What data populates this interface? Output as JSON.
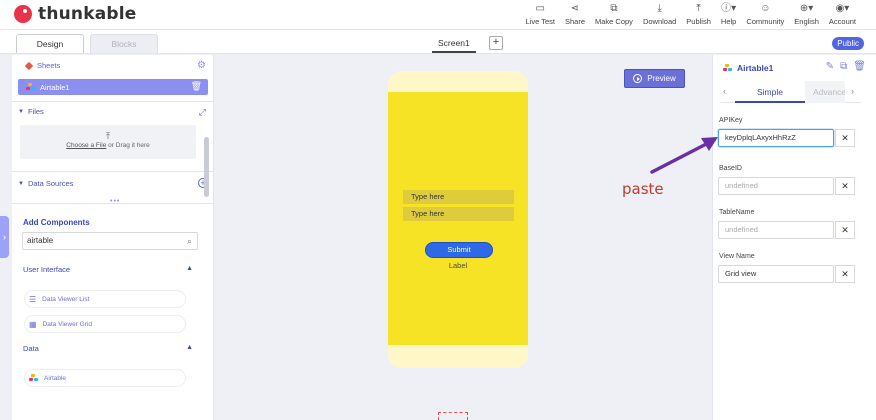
{
  "app": {
    "name": "thunkable"
  },
  "nav": [
    {
      "label": "Live Test",
      "icon": "monitor-icon",
      "glyph": "▭"
    },
    {
      "label": "Share",
      "icon": "share-icon",
      "glyph": "⋖"
    },
    {
      "label": "Make Copy",
      "icon": "copy-icon",
      "glyph": "⧉"
    },
    {
      "label": "Download",
      "icon": "download-icon",
      "glyph": "⤓"
    },
    {
      "label": "Publish",
      "icon": "upload-icon",
      "glyph": "⤒"
    },
    {
      "label": "Help",
      "icon": "help-icon",
      "glyph": "ⓘ▾"
    },
    {
      "label": "Community",
      "icon": "community-icon",
      "glyph": "☺"
    },
    {
      "label": "English",
      "icon": "globe-icon",
      "glyph": "⊕▾"
    },
    {
      "label": "Account",
      "icon": "avatar-icon",
      "glyph": "◉▾"
    }
  ],
  "tabs": {
    "design": "Design",
    "blocks": "Blocks"
  },
  "screen": {
    "name": "Screen1",
    "add": "+"
  },
  "badge": "Public",
  "left": {
    "sheets": "Sheets",
    "airtable_item": "Airtable1",
    "files": "Files",
    "dropzone": {
      "link": "Choose a File",
      "rest": " or Drag it here"
    },
    "data_sources": "Data Sources",
    "add_components": "Add Components",
    "search_value": "airtable",
    "user_interface": "User Interface",
    "ui_items": [
      "Data Viewer List",
      "Data Viewer Grid"
    ],
    "data_section": "Data",
    "data_items": [
      "Airtable"
    ]
  },
  "canvas": {
    "preview": "Preview",
    "fields": [
      "Type here",
      "Type here"
    ],
    "submit": "Submit",
    "label": "Label",
    "annotation": "paste"
  },
  "right": {
    "title": "Airtable1",
    "tab_simple": "Simple",
    "tab_advanced": "Advanced",
    "props": [
      {
        "label": "APIKey",
        "value": "keyDplqLAxyxHhRzZ",
        "placeholder": false,
        "focused": true
      },
      {
        "label": "BaseID",
        "value": "undefined",
        "placeholder": true,
        "focused": false
      },
      {
        "label": "TableName",
        "value": "undefined",
        "placeholder": true,
        "focused": false
      },
      {
        "label": "View Name",
        "value": "Grid view",
        "placeholder": false,
        "focused": false
      }
    ]
  },
  "colors": {
    "accent": "#3b47b8",
    "phone_bg": "#f6e326",
    "submit": "#2f68e8",
    "arrow": "#6a2fa5",
    "annotation": "#c0392b"
  }
}
